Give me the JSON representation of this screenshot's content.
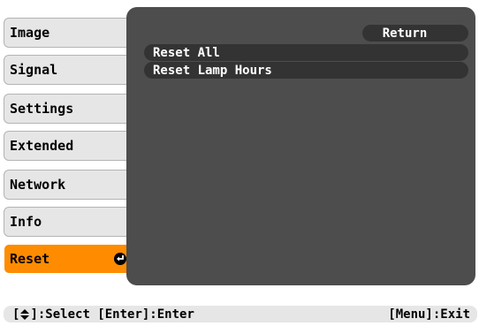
{
  "menu": {
    "items": [
      {
        "label": "Image"
      },
      {
        "label": "Signal"
      },
      {
        "label": "Settings"
      },
      {
        "label": "Extended"
      },
      {
        "label": "Network"
      },
      {
        "label": "Info"
      },
      {
        "label": "Reset",
        "active": true
      }
    ]
  },
  "panel": {
    "return_label": "Return",
    "options": [
      {
        "label": "Reset All"
      },
      {
        "label": "Reset Lamp Hours"
      }
    ]
  },
  "status_bar": {
    "select_prefix": "[",
    "select_suffix": "]:Select [Enter]:Enter",
    "menu_exit": "[Menu]:Exit"
  },
  "colors": {
    "active_tab": "#ff8c00",
    "panel_bg": "#4d4d4d",
    "row_bg": "#333333",
    "tab_bg": "#e6e6e6"
  },
  "icons": {
    "enter": "enter-icon",
    "select": "up-down-arrow-icon"
  }
}
